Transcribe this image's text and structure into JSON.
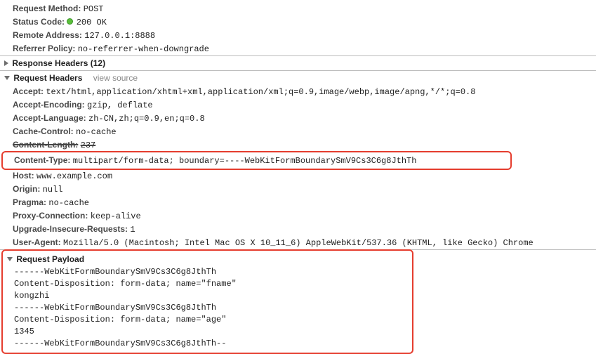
{
  "general": {
    "method_label": "Request Method:",
    "method_value": "POST",
    "status_label": "Status Code:",
    "status_value": "200 OK",
    "remote_label": "Remote Address:",
    "remote_value": "127.0.0.1:8888",
    "referrer_label": "Referrer Policy:",
    "referrer_value": "no-referrer-when-downgrade"
  },
  "response_headers": {
    "title": "Response Headers (12)"
  },
  "request_headers": {
    "title": "Request Headers",
    "view_source": "view source",
    "items": {
      "accept_label": "Accept:",
      "accept_value": "text/html,application/xhtml+xml,application/xml;q=0.9,image/webp,image/apng,*/*;q=0.8",
      "accept_encoding_label": "Accept-Encoding:",
      "accept_encoding_value": "gzip, deflate",
      "accept_language_label": "Accept-Language:",
      "accept_language_value": "zh-CN,zh;q=0.9,en;q=0.8",
      "cache_control_label": "Cache-Control:",
      "cache_control_value": "no-cache",
      "content_length_label": "Content-Length:",
      "content_length_value": "237",
      "content_type_label": "Content-Type:",
      "content_type_value": "multipart/form-data; boundary=----WebKitFormBoundarySmV9Cs3C6g8JthTh",
      "host_label": "Host:",
      "host_value": "www.example.com",
      "origin_label": "Origin:",
      "origin_value": "null",
      "pragma_label": "Pragma:",
      "pragma_value": "no-cache",
      "proxy_connection_label": "Proxy-Connection:",
      "proxy_connection_value": "keep-alive",
      "upgrade_label": "Upgrade-Insecure-Requests:",
      "upgrade_value": "1",
      "user_agent_label": "User-Agent:",
      "user_agent_value": "Mozilla/5.0 (Macintosh; Intel Mac OS X 10_11_6) AppleWebKit/537.36 (KHTML, like Gecko) Chrome"
    }
  },
  "request_payload": {
    "title": "Request Payload",
    "lines": [
      "------WebKitFormBoundarySmV9Cs3C6g8JthTh",
      "Content-Disposition: form-data; name=\"fname\"",
      "",
      "kongzhi",
      "------WebKitFormBoundarySmV9Cs3C6g8JthTh",
      "Content-Disposition: form-data; name=\"age\"",
      "",
      "1345",
      "------WebKitFormBoundarySmV9Cs3C6g8JthTh--"
    ]
  }
}
